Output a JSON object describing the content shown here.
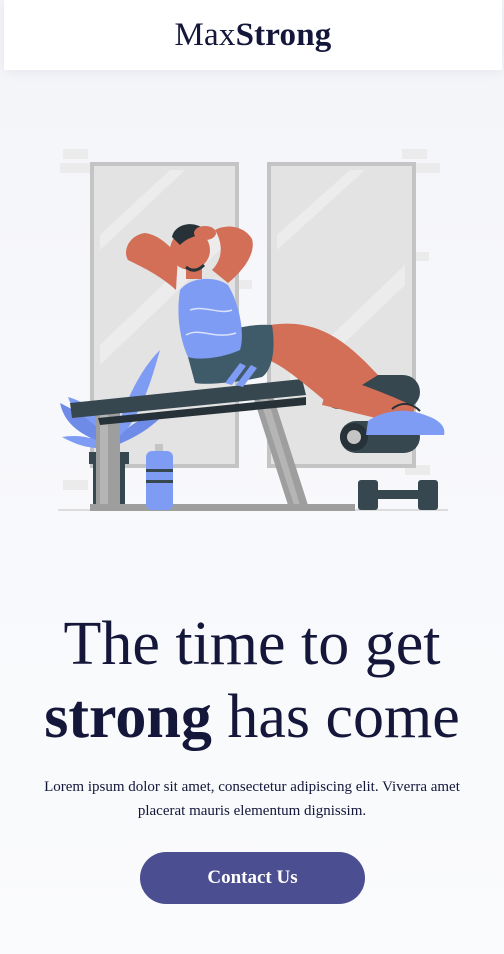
{
  "header": {
    "logo_regular": "Max",
    "logo_bold": "Strong"
  },
  "hero": {
    "headline_line1": "The time to get",
    "headline_bold": "strong",
    "headline_rest": "has come",
    "description": "Lorem ipsum dolor sit amet, consectetur adipiscing elit. Viverra amet placerat mauris elementum dignissim.",
    "cta_label": "Contact Us"
  },
  "colors": {
    "brand": "#14163a",
    "button": "#4b4f91",
    "accent_blue": "#7f9cf5",
    "skin": "#d46f57"
  }
}
